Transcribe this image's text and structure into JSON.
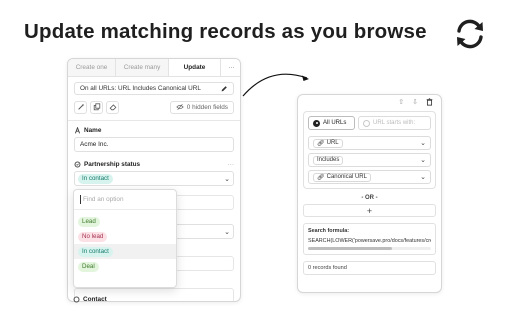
{
  "headline": "Update matching records as you browse",
  "icons": {
    "refresh": "refresh-icon",
    "edit": "pencil-icon",
    "magic": "wand-icon",
    "copy": "copy-icon",
    "erase": "eraser-icon",
    "hidden": "eye-off-icon",
    "name_field": "text-icon",
    "status_field": "circle-icon",
    "link": "link-icon",
    "move_up": "arrow-up-icon",
    "move_down": "arrow-down-icon",
    "delete": "trash-icon"
  },
  "left_panel": {
    "tabs": [
      "Create one",
      "Create many",
      "Update",
      "···"
    ],
    "active_tab": "Update",
    "filter_text": "On all URLs: URL Includes Canonical URL",
    "hidden_fields": "0 hidden fields",
    "name_label": "Name",
    "name_value": "Acme Inc.",
    "status_label": "Partnership status",
    "status_more": "···",
    "status_value": "In contact",
    "contact_label": "Contact"
  },
  "dropdown": {
    "placeholder": "Find an option",
    "options": [
      "Lead",
      "No lead",
      "In contact",
      "Deal"
    ],
    "hovered": "In contact"
  },
  "right_panel": {
    "segment_all": "All URLs",
    "segment_starts": "URL starts with:",
    "field_select": "URL",
    "operator_select": "Includes",
    "value_select": "Canonical URL",
    "or_label": "- OR -",
    "add_label": "+",
    "formula_title": "Search formula:",
    "formula_text": "SEARCH(LOWER('powersave.pro/docs/features/create",
    "scroll_fraction": 0.68,
    "records_found": "0 records found"
  },
  "colors": {
    "tag_contact_bg": "#d7f3ee",
    "tag_lead_bg": "#e3f5dd",
    "tag_nolead_bg": "#fbe1e6"
  }
}
